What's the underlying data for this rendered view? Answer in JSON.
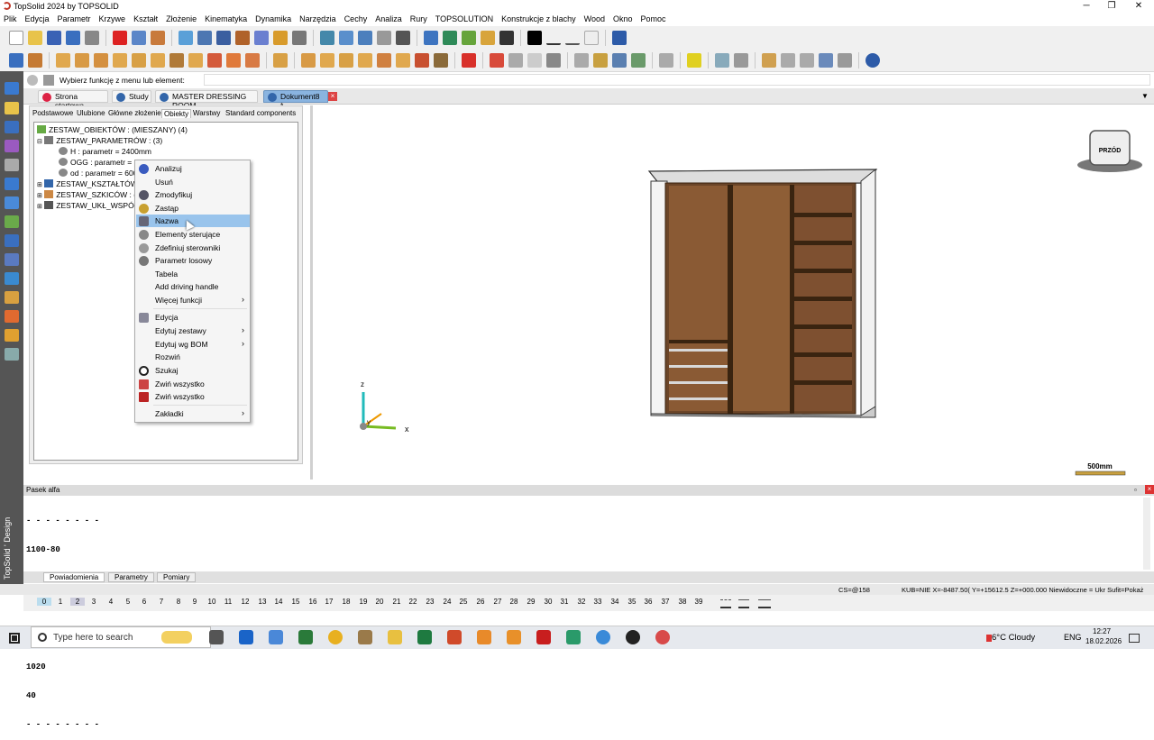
{
  "window": {
    "title": "TopSolid 2024 by TOPSOLID",
    "min": "─",
    "max": "❐",
    "close": "✕"
  },
  "menu": [
    "Plik",
    "Edycja",
    "Parametr",
    "Krzywe",
    "Kształt",
    "Złożenie",
    "Kinematyka",
    "Dynamika",
    "Narzędzia",
    "Cechy",
    "Analiza",
    "Rury",
    "TOPSOLUTION",
    "Konstrukcje z blachy",
    "Wood",
    "Okno",
    "Pomoc"
  ],
  "command": {
    "prompt": "Wybierz funkcję z menu lub element:"
  },
  "doc_tabs": [
    "Strona startowa",
    "Study",
    "MASTER DRESSING ROOM",
    "Dokument8 *"
  ],
  "doc_tab_close": "×",
  "panel": {
    "tabs": [
      "Podstawowe",
      "Ulubione",
      "Główne złożenie",
      "Obiekty",
      "Warstwy",
      "Standard components"
    ],
    "active_tab": "Obiekty"
  },
  "tree": [
    {
      "text": "ZESTAW_OBIEKTÓW : (MIESZANY) (4)",
      "level": 0
    },
    {
      "text": "ZESTAW_PARAMETRÓW : (3)",
      "level": 1
    },
    {
      "text": "H : parametr = 2400mm",
      "level": 2
    },
    {
      "text": "OGG : parametr = 18",
      "level": 2
    },
    {
      "text": "od : parametr = 600",
      "level": 2
    },
    {
      "text": "ZESTAW_KSZTAŁTÓW",
      "level": 1
    },
    {
      "text": "ZESTAW_SZKICÓW : (",
      "level": 1
    },
    {
      "text": "ZESTAW_UKŁ_WSPÓŁ",
      "level": 1
    }
  ],
  "context_menu": {
    "items": [
      {
        "label": "Analizuj",
        "icon": "info-icon"
      },
      {
        "label": "Usuń",
        "icon": ""
      },
      {
        "label": "Zmodyfikuj",
        "icon": "modify-icon"
      },
      {
        "label": "Zastąp",
        "icon": "replace-icon"
      },
      {
        "label": "Nazwa",
        "icon": "name-icon",
        "highlighted": true
      },
      {
        "label": "Elementy sterujące",
        "icon": "control-icon"
      },
      {
        "label": "Zdefiniuj sterowniki",
        "icon": "driver-icon"
      },
      {
        "label": "Parametr losowy",
        "icon": "random-icon"
      },
      {
        "label": "Tabela",
        "icon": ""
      },
      {
        "label": "Add driving handle",
        "icon": ""
      },
      {
        "label": "Więcej funkcji",
        "icon": "",
        "submenu": true
      },
      {
        "label": "Edycja",
        "icon": "edit-icon",
        "group": 2
      },
      {
        "label": "Edytuj zestawy",
        "icon": "",
        "submenu": true
      },
      {
        "label": "Edytuj wg BOM",
        "icon": "",
        "submenu": true
      },
      {
        "label": "Rozwiń",
        "icon": ""
      },
      {
        "label": "Szukaj",
        "icon": "search-icon"
      },
      {
        "label": "Zwiń wszystko",
        "icon": "collapse-icon"
      },
      {
        "label": "Zwiń wszystko",
        "icon": "collapse-red-icon"
      },
      {
        "label": "Zakładki",
        "icon": "",
        "submenu": true,
        "group": 3
      }
    ],
    "submenu_arrow": "›"
  },
  "viewport": {
    "view_cube_label": "PRZÓD",
    "scale_label": "500mm",
    "axis_z": "z",
    "axis_x": "x",
    "axis_y": "y"
  },
  "alpha": {
    "title": "Pasek alfa",
    "lines": [
      "- - - - - - - -",
      "1100-80",
      "40",
      "40",
      "1020",
      "1020",
      "40",
      "- - - - - - - -"
    ]
  },
  "bottom_tabs": [
    "Powiadomienia",
    "Parametry",
    "Pomiary"
  ],
  "status": {
    "cs": "CS=@158",
    "coords": "KUB=NIE  X=-8487.50(  Y=+15612.5  Z=+000.000  Niewidoczne = Ukr  Sufit=Pokaż"
  },
  "layers": [
    "0",
    "1",
    "2",
    "3",
    "4",
    "5",
    "6",
    "7",
    "8",
    "9",
    "10",
    "11",
    "12",
    "13",
    "14",
    "15",
    "16",
    "17",
    "18",
    "19",
    "20",
    "21",
    "22",
    "23",
    "24",
    "25",
    "26",
    "27",
    "28",
    "29",
    "30",
    "31",
    "32",
    "33",
    "34",
    "35",
    "36",
    "37",
    "38",
    "39"
  ],
  "brand": "TopSolid ' Design",
  "taskbar": {
    "search_placeholder": "Type here to search",
    "weather": "6°C  Cloudy",
    "lang": "ENG",
    "time": "12:27",
    "date": "18.02.2026"
  }
}
